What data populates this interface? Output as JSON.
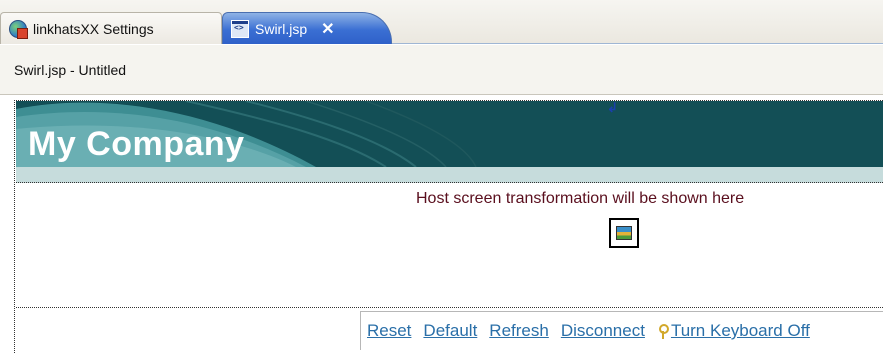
{
  "tabs": [
    {
      "label": "linkhatsXX Settings",
      "icon": "globe-settings-icon"
    },
    {
      "label": "Swirl.jsp",
      "icon": "jsp-file-icon",
      "close_label": "✕"
    }
  ],
  "editor": {
    "title": "Swirl.jsp - Untitled"
  },
  "banner": {
    "title": "My Company"
  },
  "content": {
    "enter_glyph": "↲",
    "host_text": "Host screen transformation will be shown here"
  },
  "links": {
    "reset": "Reset",
    "default": "Default",
    "refresh": "Refresh",
    "disconnect": "Disconnect",
    "keyboard": "Turn Keyboard Off"
  },
  "colors": {
    "banner_dark": "#134f56",
    "banner_strip": "#c6dcdc",
    "link": "#2a6fa8",
    "host_text": "#5a0f1e",
    "active_tab": "#3a6fd3"
  }
}
